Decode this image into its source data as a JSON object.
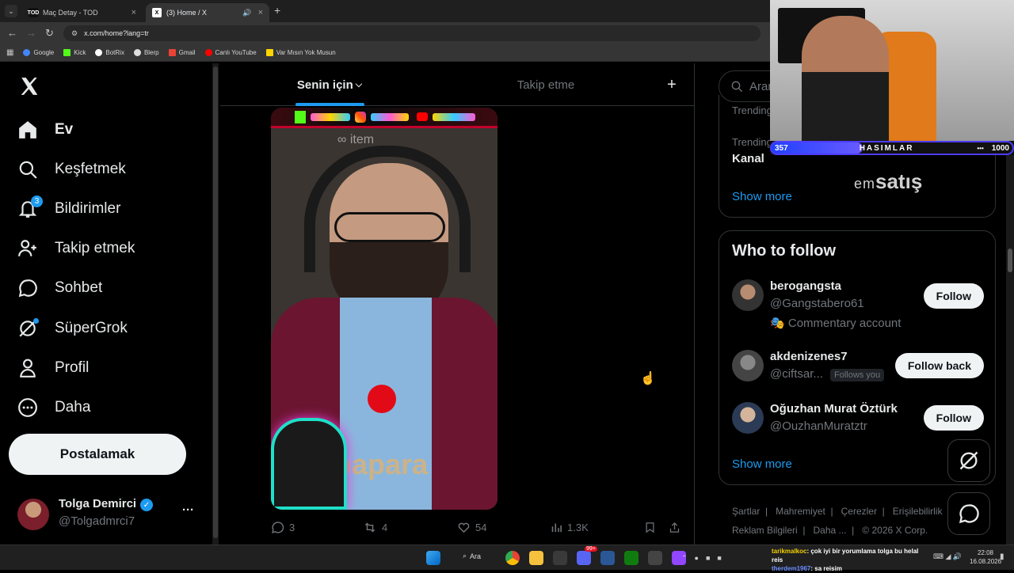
{
  "browser": {
    "tabs": [
      {
        "title": "Maç Detay - TOD",
        "favicon": "TOD",
        "active": false
      },
      {
        "title": "(3) Home / X",
        "favicon": "X",
        "active": true
      }
    ],
    "new_tab_label": "+",
    "address": "x.com/home?lang=tr",
    "bookmarks": [
      {
        "label": "Google",
        "color": "#4285f4"
      },
      {
        "label": "Kick",
        "color": "#53fc18"
      },
      {
        "label": "BotRix",
        "color": "#ffffff"
      },
      {
        "label": "Blerp",
        "color": "#e0e0e0"
      },
      {
        "label": "Gmail",
        "color": "#ea4335"
      },
      {
        "label": "Canlı YouTube",
        "color": "#ff0000"
      },
      {
        "label": "Var Mısın Yok Musun",
        "color": "#ffd400"
      }
    ]
  },
  "nav": {
    "items": [
      {
        "label": "Ev",
        "icon": "home-icon",
        "bold": true
      },
      {
        "label": "Keşfetmek",
        "icon": "search-icon"
      },
      {
        "label": "Bildirimler",
        "icon": "bell-icon",
        "badge": "3"
      },
      {
        "label": "Takip etmek",
        "icon": "follow-icon"
      },
      {
        "label": "Sohbet",
        "icon": "chat-icon"
      },
      {
        "label": "SüperGrok",
        "icon": "grok-icon"
      },
      {
        "label": "Profil",
        "icon": "profile-icon"
      },
      {
        "label": "Daha",
        "icon": "more-icon"
      }
    ],
    "post_label": "Postalamak",
    "account": {
      "name": "Tolga Demirci",
      "handle": "@Tolgadmrci7",
      "more": "···"
    }
  },
  "feed": {
    "tabs": [
      {
        "label": "Senin için",
        "active": true
      },
      {
        "label": "Takip etme",
        "active": false
      }
    ],
    "add_tab_label": "+",
    "media_overlay": {
      "watermark": "item",
      "logo": "item"
    },
    "stats": {
      "replies": "3",
      "reposts": "4",
      "likes": "54",
      "views": "1.3K"
    }
  },
  "sidebar": {
    "search_placeholder": "Aram",
    "trending_top_label": "Trending",
    "trending_item": {
      "label": "Trending",
      "title": "Kanal"
    },
    "show_more_1": "Show more",
    "overlay_brand": {
      "prefix": "em",
      "main": "satış"
    },
    "who_to_follow": {
      "title": "Who to follow",
      "people": [
        {
          "name": "berogangsta",
          "handle": "@Gangstabero61",
          "extra": "Commentary account",
          "button": "Follow"
        },
        {
          "name": "akdenizenes7",
          "handle": "@ciftsar...",
          "follows_you": "Follows you",
          "button": "Follow back"
        },
        {
          "name": "Oğuzhan Murat Öztürk",
          "handle": "@OuzhanMuratztr",
          "button": "Follow"
        }
      ],
      "show_more": "Show more"
    },
    "footer": {
      "row1": [
        "Şartlar",
        "Mahremiyet",
        "Çerezler",
        "Erişilebilirlik"
      ],
      "row2": [
        "Reklam Bilgileri",
        "Daha ...",
        "© 2026 X Corp."
      ]
    }
  },
  "webcam_overlay": {
    "left_count": "357",
    "label": "HASIMLAR",
    "dots": "•••",
    "right_count": "1000"
  },
  "taskbar": {
    "search_label": "Ara",
    "notification_badge": "99+",
    "chat_lines": [
      {
        "user": "tarikmalkoc",
        "text": ": çok iyi bir yorumlama tolga bu helal reis"
      },
      {
        "user": "therdem1967",
        "text": ": sa reisim"
      }
    ],
    "time": "22:08",
    "date": "16.08.2026"
  },
  "colors": {
    "accent": "#1d9bf0",
    "background": "#000000",
    "text": "#e7e9ea",
    "muted": "#71767b",
    "border": "#2f3336"
  }
}
